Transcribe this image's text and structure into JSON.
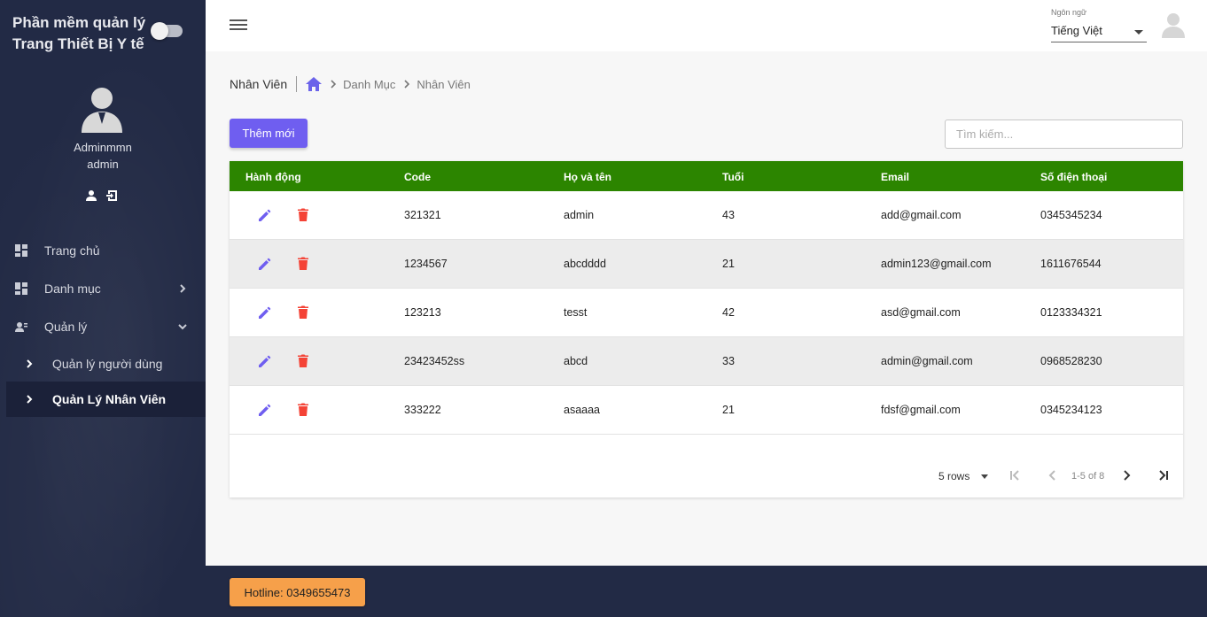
{
  "sidebar": {
    "title": "Phần mềm quản lý Trang Thiết Bị Y tế",
    "user": {
      "name": "Adminmmn",
      "role": "admin"
    },
    "nav": [
      {
        "label": "Trang chủ",
        "icon": "dashboard-icon"
      },
      {
        "label": "Danh mục",
        "icon": "dashboard-icon"
      },
      {
        "label": "Quản lý",
        "icon": "manage-users-icon"
      }
    ],
    "sub_items": [
      {
        "label": "Quản lý người dùng"
      },
      {
        "label": "Quản Lý Nhân Viên"
      }
    ]
  },
  "topbar": {
    "lang_label": "Ngôn ngữ",
    "lang_value": "Tiếng Việt"
  },
  "page": {
    "title": "Nhân Viên",
    "breadcrumb": [
      "Danh Mục",
      "Nhân Viên"
    ],
    "add_label": "Thêm mới",
    "search_placeholder": "Tìm kiếm..."
  },
  "table": {
    "columns": [
      "Hành động",
      "Code",
      "Họ và tên",
      "Tuổi",
      "Email",
      "Số điện thoại"
    ],
    "rows": [
      {
        "code": "321321",
        "name": "admin",
        "age": "43",
        "email": "add@gmail.com",
        "phone": "0345345234"
      },
      {
        "code": "1234567",
        "name": "abcdddd",
        "age": "21",
        "email": "admin123@gmail.com",
        "phone": "1611676544"
      },
      {
        "code": "123213",
        "name": "tesst",
        "age": "42",
        "email": "asd@gmail.com",
        "phone": "0123334321"
      },
      {
        "code": "23423452ss",
        "name": "abcd",
        "age": "33",
        "email": "admin@gmail.com",
        "phone": "0968528230"
      },
      {
        "code": "333222",
        "name": "asaaaa",
        "age": "21",
        "email": "fdsf@gmail.com",
        "phone": "0345234123"
      }
    ]
  },
  "pagination": {
    "rows_per_page": "5 rows",
    "range": "1-5 of 8"
  },
  "footer": {
    "hotline": "Hotline: 0349655473"
  },
  "colors": {
    "sidebar": "#222a45",
    "accent": "#6f5ef0",
    "table_header": "#2c8500",
    "delete": "#f44336",
    "hotline": "#f6a04a"
  }
}
